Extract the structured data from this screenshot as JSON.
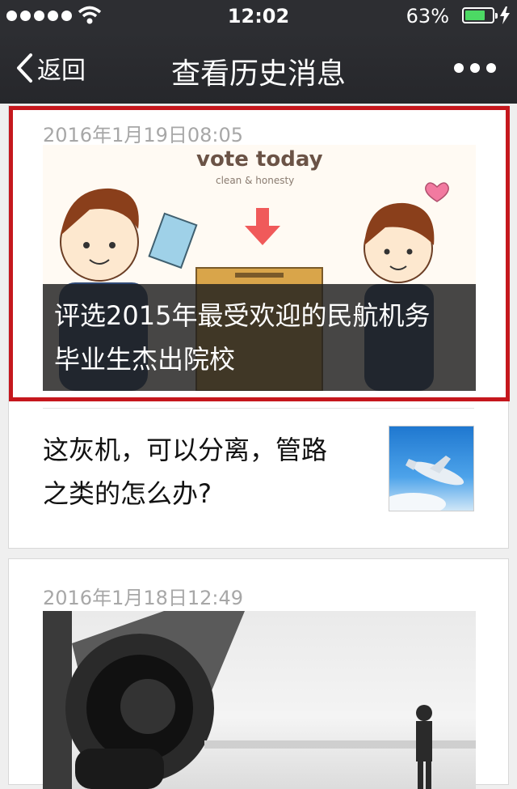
{
  "status_bar": {
    "time": "12:02",
    "battery": "63%"
  },
  "nav": {
    "back_label": "返回",
    "title": "查看历史消息"
  },
  "articles": [
    {
      "date": "2016年1月19日08:05",
      "image_text": "vote  today",
      "image_subtext": "clean & honesty",
      "title": "评选2015年最受欢迎的民航机务毕业生杰出院校",
      "title_lines": [
        "评选2015年最受欢迎的民航机务",
        "毕业生杰出院校"
      ]
    },
    {
      "title_lines": [
        "这灰机，可以分离，管路",
        "之类的怎么办?"
      ]
    },
    {
      "date": "2016年1月18日12:49"
    }
  ],
  "colors": {
    "highlight": "#c5171d",
    "battery": "#4cd964",
    "bar": "#2d2e32"
  }
}
